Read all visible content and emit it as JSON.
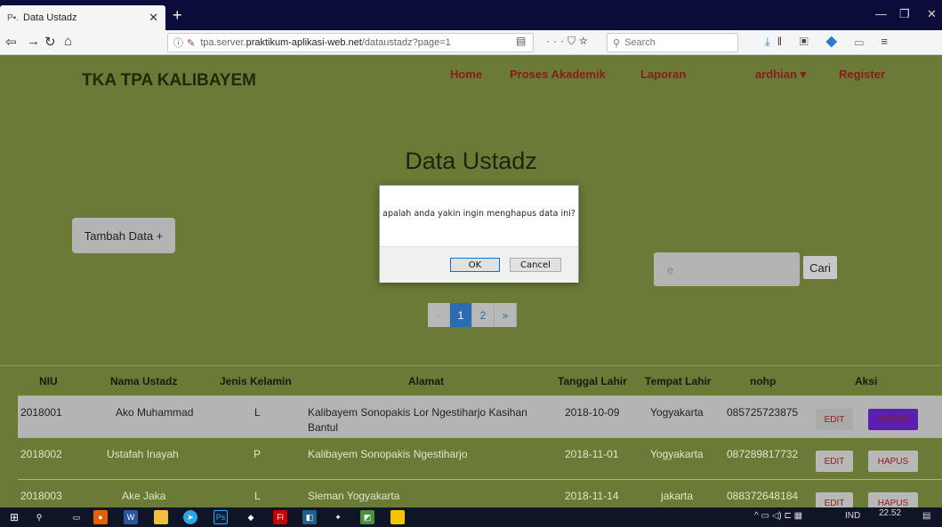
{
  "browser": {
    "tab_icon": "P▪.",
    "tab_title": "Data Ustadz",
    "url_prefix": "tpa.server.",
    "url_host": "praktikum-aplikasi-web.net",
    "url_path": "/dataustadz?page=1",
    "search_placeholder": "Search"
  },
  "header": {
    "brand": "TKA TPA KALIBAYEM",
    "menu": [
      "Home",
      "Proses Akademik",
      "Laporan",
      "ardhian ▾",
      "Register"
    ]
  },
  "page": {
    "title": "Data Ustadz",
    "add_button": "Tambah Data +",
    "search_value": "e",
    "search_button": "Cari"
  },
  "pagination": [
    "«",
    "1",
    "2",
    "»"
  ],
  "dialog": {
    "message": "apalah anda yakin ingin menghapus data ini?",
    "ok": "OK",
    "cancel": "Cancel"
  },
  "table": {
    "headers": [
      "NIU",
      "Nama Ustadz",
      "Jenis Kelamin",
      "Alamat",
      "Tanggal Lahir",
      "Tempat Lahir",
      "nohp",
      "Aksi"
    ],
    "rows": [
      [
        "2018001",
        "Ako Muhammad",
        "L",
        "Kalibayem Sonopakis Lor Ngestiharjo Kasihan Bantul",
        "2018-10-09",
        "Yogyakarta",
        "085725723875"
      ],
      [
        "2018002",
        "Ustafah Inayah",
        "P",
        "Kalibayem Sonopakis Ngestiharjo",
        "2018-11-01",
        "Yogyakarta",
        "087289817732"
      ],
      [
        "2018003",
        "Ake Jaka",
        "L",
        "Sleman Yogyakarta",
        "2018-11-14",
        "jakarta",
        "088372648184"
      ]
    ],
    "edit_label": "EDIT",
    "delete_label": "HAPUS"
  },
  "taskbar": {
    "lang": "IND",
    "time": "22.52"
  },
  "colors": {
    "page_bg": "#6b7a36",
    "menu_link": "#8a1c1c",
    "active_page": "#2b6cb0",
    "hapus_hover": "#5b1fb0"
  }
}
